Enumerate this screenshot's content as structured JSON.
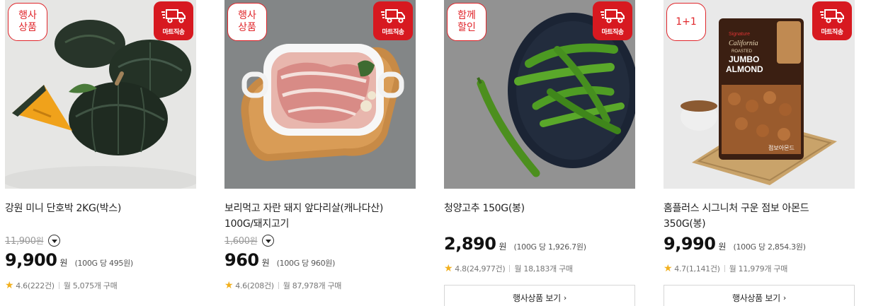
{
  "colors": {
    "accent": "#d71920",
    "star": "#f2b01e"
  },
  "delivery_badge_label": "마트직송",
  "products": [
    {
      "event_badge": "행사\n상품",
      "name": "강원 미니 단호박 2KG(박스)",
      "original_price": "11,900",
      "original_won": "원",
      "price": "9,900",
      "won": "원",
      "unit_price": "(100G 당 495원)",
      "rating": "4.6(222건)",
      "monthly": "월 5,075개 구매",
      "image_icon": "pumpkin-image"
    },
    {
      "event_badge": "행사\n상품",
      "name": "보리먹고 자란 돼지 앞다리살(캐나다산)\n100G/돼지고기",
      "original_price": "1,600",
      "original_won": "원",
      "price": "960",
      "won": "원",
      "unit_price": "(100G 당 960원)",
      "rating": "4.6(208건)",
      "monthly": "월 87,978개 구매",
      "image_icon": "pork-image"
    },
    {
      "event_badge": "함께\n할인",
      "name": "청양고추 150G(봉)",
      "price": "2,890",
      "won": "원",
      "unit_price": "(100G 당 1,926.7원)",
      "rating": "4.8(24,977건)",
      "monthly": "월 18,183개 구매",
      "button_label": "행사상품 보기",
      "image_icon": "pepper-image"
    },
    {
      "event_badge": "1+1",
      "name": "홈플러스 시그니처 구운 점보 아몬드\n350G(봉)",
      "price": "9,990",
      "won": "원",
      "unit_price": "(100G 당 2,854.3원)",
      "rating": "4.7(1,141건)",
      "monthly": "월 11,979개 구매",
      "button_label": "행사상품 보기",
      "image_icon": "almond-image",
      "package_text": {
        "brand": "Signature",
        "line1": "California",
        "line2": "ROASTED",
        "line3": "JUMBO",
        "line4": "ALMOND",
        "korean": "점보아몬드"
      }
    }
  ]
}
